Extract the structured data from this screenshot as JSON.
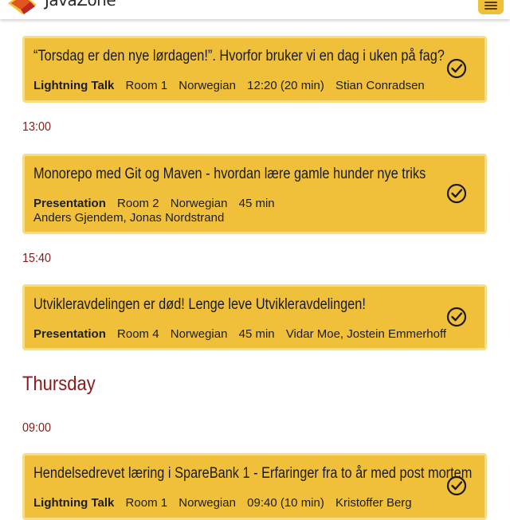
{
  "header": {
    "brand": "JavaZone",
    "logo_icon": "javazone-logo-icon",
    "menu_icon": "hamburger-menu-icon"
  },
  "colors": {
    "card": "#f0c03a",
    "card_border": "#f7dd86",
    "accent": "#8b1a1a"
  },
  "schedule": {
    "talk1": {
      "title": "“Torsdag er den nye lørdagen!”. Hvorfor bruker vi en dag i uken på fag?",
      "format": "Lightning Talk",
      "room": "Room 1",
      "language": "Norwegian",
      "duration": "12:20 (20 min)",
      "speakers": "Stian Conradsen"
    },
    "time1": "13:00",
    "talk2": {
      "title": "Monorepo med Git og Maven - hvordan lære gamle hunder nye triks",
      "format": "Presentation",
      "room": "Room 2",
      "language": "Norwegian",
      "duration": "45 min",
      "speakers": "Anders Gjendem, Jonas Nordstrand"
    },
    "time2": "15:40",
    "talk3": {
      "title": "Utvikleravdelingen er død! Lenge leve Utvikleravdelingen!",
      "format": "Presentation",
      "room": "Room 4",
      "language": "Norwegian",
      "duration": "45 min",
      "speakers": "Vidar Moe, Jostein Emmerhoff"
    },
    "day": "Thursday",
    "time3": "09:00",
    "talk4": {
      "title": "Hendelsedrevet læring i SpareBank 1 - Erfaringer fra to år med post mortem",
      "format": "Lightning Talk",
      "room": "Room 1",
      "language": "Norwegian",
      "duration": "09:40 (10 min)",
      "speakers": "Kristoffer Berg"
    }
  }
}
